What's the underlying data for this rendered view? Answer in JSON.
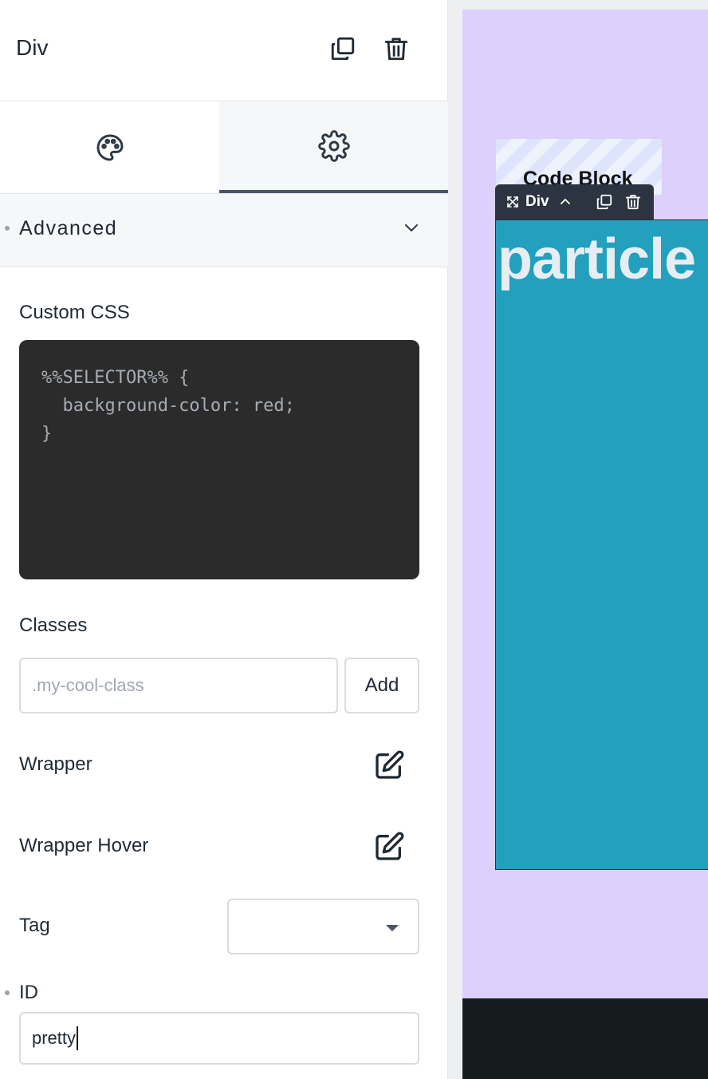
{
  "header": {
    "title": "Div"
  },
  "tabs": [
    {
      "icon": "palette-icon",
      "active": false
    },
    {
      "icon": "gear-icon",
      "active": true
    }
  ],
  "section": {
    "title": "Advanced"
  },
  "custom_css": {
    "label": "Custom CSS",
    "lines": [
      "%%SELECTOR%% {",
      "  background-color: red;",
      "}"
    ]
  },
  "classes": {
    "label": "Classes",
    "placeholder": ".my-cool-class",
    "add_label": "Add"
  },
  "wrapper": {
    "label": "Wrapper"
  },
  "wrapper_hover": {
    "label": "Wrapper Hover"
  },
  "tag": {
    "label": "Tag",
    "value": ""
  },
  "id_field": {
    "label": "ID",
    "value": "pretty"
  },
  "canvas": {
    "code_block_label": "Code Block",
    "toolbar_label": "Div",
    "content_text": "particle",
    "colors": {
      "background": "#ddd0fc",
      "selected_div": "#22a0bd",
      "toolbar": "#2b3440",
      "footer": "#161c1b"
    }
  }
}
